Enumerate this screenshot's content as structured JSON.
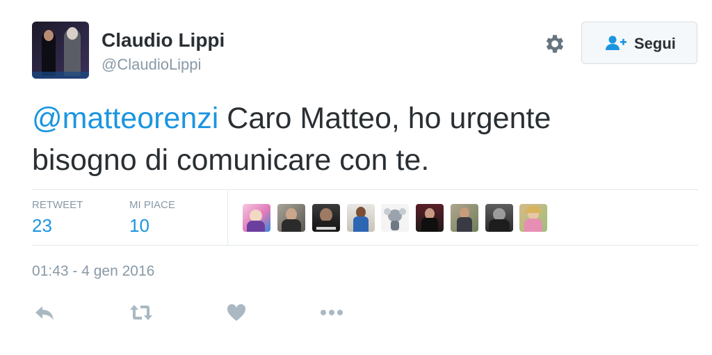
{
  "user": {
    "name": "Claudio Lippi",
    "handle": "@ClaudioLippi"
  },
  "follow_button": {
    "label": "Segui"
  },
  "tweet": {
    "mention": "@matteorenzi",
    "line1_rest": " Caro Matteo, ho urgente",
    "line2": "bisogno di comunicare con te."
  },
  "stats": {
    "retweets": {
      "label": "RETWEET",
      "value": "23"
    },
    "likes": {
      "label": "MI PIACE",
      "value": "10"
    }
  },
  "likers_count_shown": 9,
  "timestamp": "01:43 - 4 gen 2016",
  "colors": {
    "link": "#1b95e0",
    "text": "#292f33",
    "muted": "#8899a6",
    "divider": "#e1e8ed",
    "icon": "#aab8c2"
  },
  "icons": {
    "settings": "gear-icon",
    "follow": "add-user-icon",
    "reply": "reply-icon",
    "retweet": "retweet-icon",
    "like": "heart-icon",
    "more": "more-icon"
  }
}
